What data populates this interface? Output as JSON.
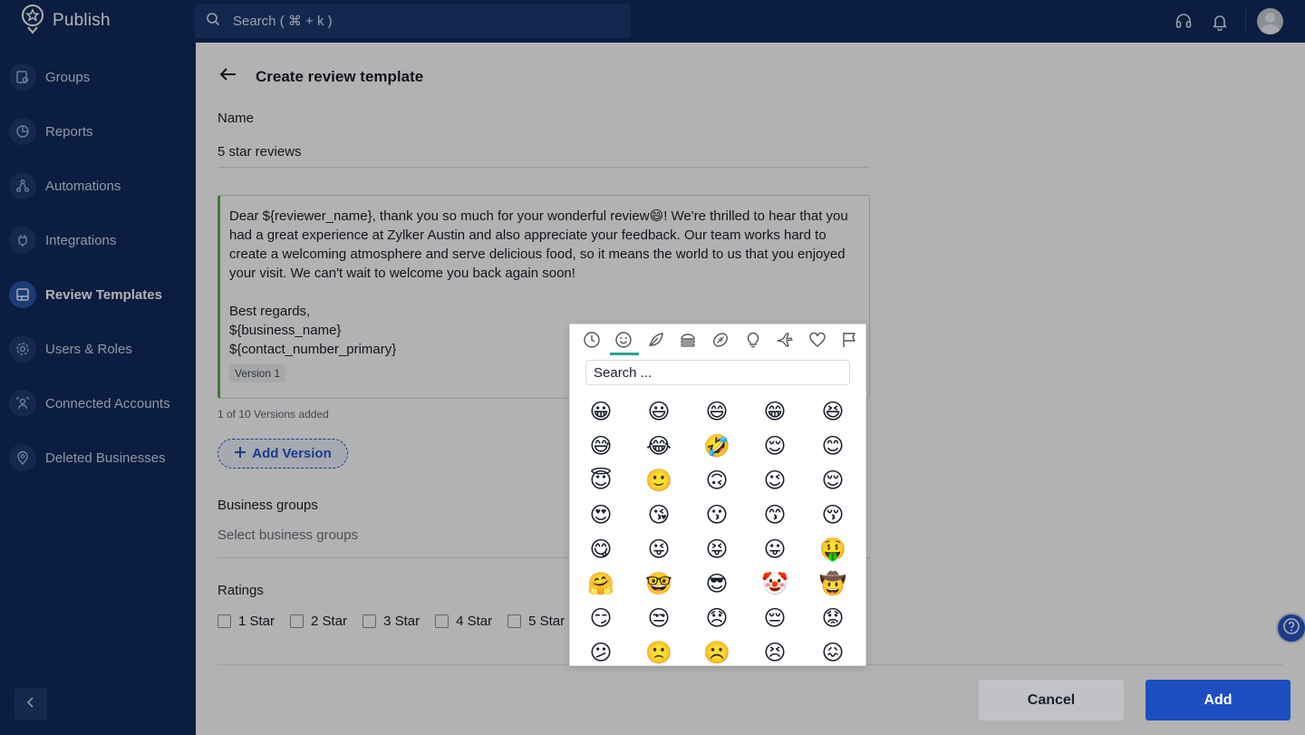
{
  "app": {
    "name": "Publish"
  },
  "search": {
    "placeholder": "Search ( ⌘ + k )"
  },
  "sidebar": {
    "items": [
      {
        "label": "Groups",
        "icon": "groups-icon"
      },
      {
        "label": "Reports",
        "icon": "reports-icon"
      },
      {
        "label": "Automations",
        "icon": "automations-icon"
      },
      {
        "label": "Integrations",
        "icon": "integrations-icon"
      },
      {
        "label": "Review Templates",
        "icon": "review-templates-icon",
        "active": true
      },
      {
        "label": "Users & Roles",
        "icon": "users-roles-icon"
      },
      {
        "label": "Connected Accounts",
        "icon": "connected-accounts-icon"
      },
      {
        "label": "Deleted Businesses",
        "icon": "deleted-businesses-icon"
      }
    ]
  },
  "page": {
    "title": "Create review template"
  },
  "form": {
    "name_label": "Name",
    "name_value": "5 star reviews",
    "message": {
      "body": "Dear ${reviewer_name}, thank you so much for your wonderful review😄! We're thrilled to hear that you had a great experience at Zylker Austin and also appreciate your feedback. Our team works hard to create a welcoming atmosphere and serve delicious food, so it means the world to us that you enjoyed your visit. We can't wait to welcome you back again soon!",
      "signoff": "Best regards,\n${business_name}\n${contact_number_primary}",
      "version_tag": "Version 1"
    },
    "versions_count": "1 of 10 Versions added",
    "add_version_label": "Add Version",
    "business_groups_label": "Business groups",
    "business_groups_placeholder": "Select business groups",
    "ratings_label": "Ratings",
    "ratings": [
      "1 Star",
      "2 Star",
      "3 Star",
      "4 Star",
      "5 Star"
    ]
  },
  "buttons": {
    "cancel": "Cancel",
    "add": "Add"
  },
  "emoji_picker": {
    "categories": [
      "recent-clock-icon",
      "smiley-icon",
      "leaf-icon",
      "burger-icon",
      "ball-icon",
      "bulb-icon",
      "plane-icon",
      "heart-icon",
      "flag-icon"
    ],
    "active_category": "smiley-icon",
    "search_placeholder": "Search ...",
    "emojis": [
      "😀",
      "😃",
      "😄",
      "😁",
      "😆",
      "😅",
      "😂",
      "🤣",
      "😌",
      "😊",
      "😇",
      "🙂",
      "🙃",
      "😉",
      "😌",
      "😍",
      "😘",
      "😗",
      "😙",
      "😚",
      "😋",
      "😜",
      "😝",
      "😛",
      "🤑",
      "🤗",
      "🤓",
      "😎",
      "🤡",
      "🤠",
      "😏",
      "😒",
      "😞",
      "😔",
      "😟",
      "😕",
      "🙁",
      "☹️",
      "😣",
      "😖"
    ]
  },
  "colors": {
    "sidebar": "#102a5c",
    "primary": "#1d4ec1",
    "accent_green": "#55b04a"
  }
}
